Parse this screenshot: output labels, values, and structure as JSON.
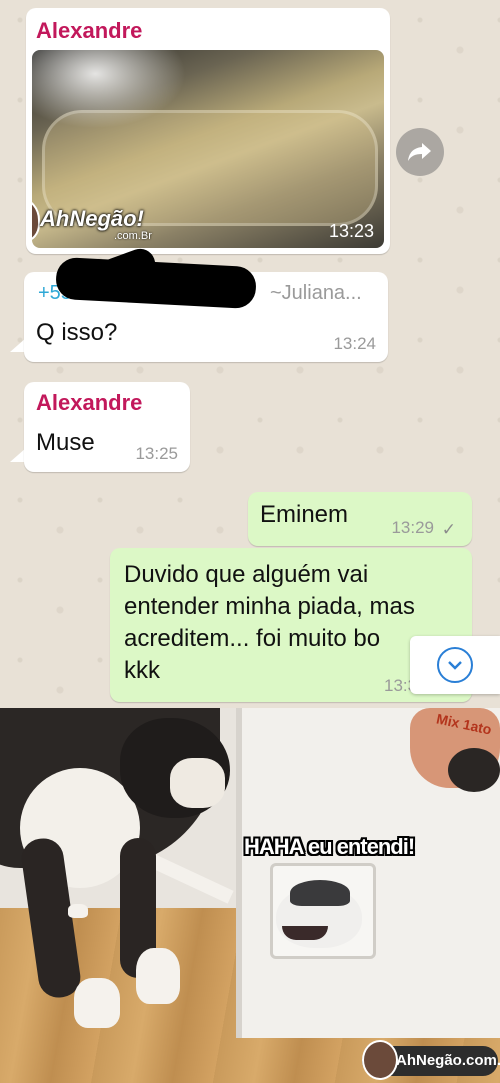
{
  "messages": [
    {
      "sender": "Alexandre",
      "time": "13:23",
      "type": "image"
    },
    {
      "sender_number": "+55 61",
      "sender_name": "~Juliana...",
      "text": "Q isso?",
      "time": "13:24"
    },
    {
      "sender": "Alexandre",
      "text": "Muse",
      "time": "13:25"
    },
    {
      "text": "Eminem",
      "time": "13:29",
      "status": "✓"
    },
    {
      "text_lines": [
        "Duvido que alguém vai",
        "entender minha piada, mas",
        "acreditem... foi muito bo",
        "kkk"
      ],
      "time": "13:3"
    }
  ],
  "watermark": {
    "brand": "AhNegão!",
    "domain": ".com.Br"
  },
  "meme": {
    "caption": "HAHA eu entendi!",
    "bag_text": "Mix 1ato",
    "site": "AhNegão.com.br"
  },
  "icons": {
    "forward": "forward-arrow-icon",
    "scroll": "chevron-down-icon"
  },
  "colors": {
    "sender": "#c2185b",
    "outgoing": "#dcf8c6",
    "incoming": "#ffffff",
    "accent": "#2a7fd6"
  }
}
